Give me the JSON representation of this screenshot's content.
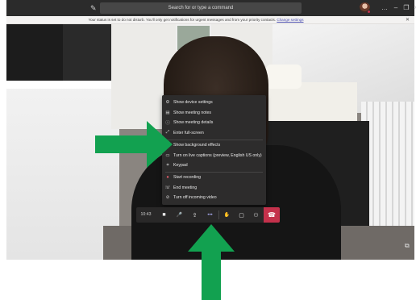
{
  "titlebar": {
    "compose_icon": "compose-icon",
    "search_placeholder": "Search for or type a command",
    "window_controls": [
      "…",
      "–",
      "❐",
      "✕"
    ]
  },
  "notification": {
    "text": "Your status is set to do not disturb. You'll only get notifications for urgent messages and from your priority contacts.",
    "link": "Change settings",
    "close": "✕"
  },
  "menu": {
    "items": [
      {
        "icon": "⚙",
        "label": "Show device settings"
      },
      {
        "icon": "▤",
        "label": "Show meeting notes"
      },
      {
        "icon": "ⓘ",
        "label": "Show meeting details"
      },
      {
        "icon": "⤢",
        "label": "Enter full-screen"
      },
      {
        "icon": "▨",
        "label": "Show background effects"
      },
      {
        "icon": "▭",
        "label": "Turn on live captions (preview, English US only)"
      },
      {
        "icon": "⌗",
        "label": "Keypad"
      },
      {
        "icon": "●",
        "label": "Start recording"
      },
      {
        "icon": "☏",
        "label": "End meeting"
      },
      {
        "icon": "⊘",
        "label": "Turn off incoming video"
      }
    ]
  },
  "controls": {
    "timer": "10:43",
    "camera_icon": "■",
    "mic_icon": "🎤",
    "share_icon": "⇪",
    "more_icon": "•••",
    "raise_hand_icon": "✋",
    "chat_icon": "▢",
    "participants_icon": "⚇",
    "hangup_icon": "☎"
  },
  "colors": {
    "accent": "#4f52b2",
    "hangup": "#c4314b",
    "annotation_arrow": "#12a150"
  }
}
